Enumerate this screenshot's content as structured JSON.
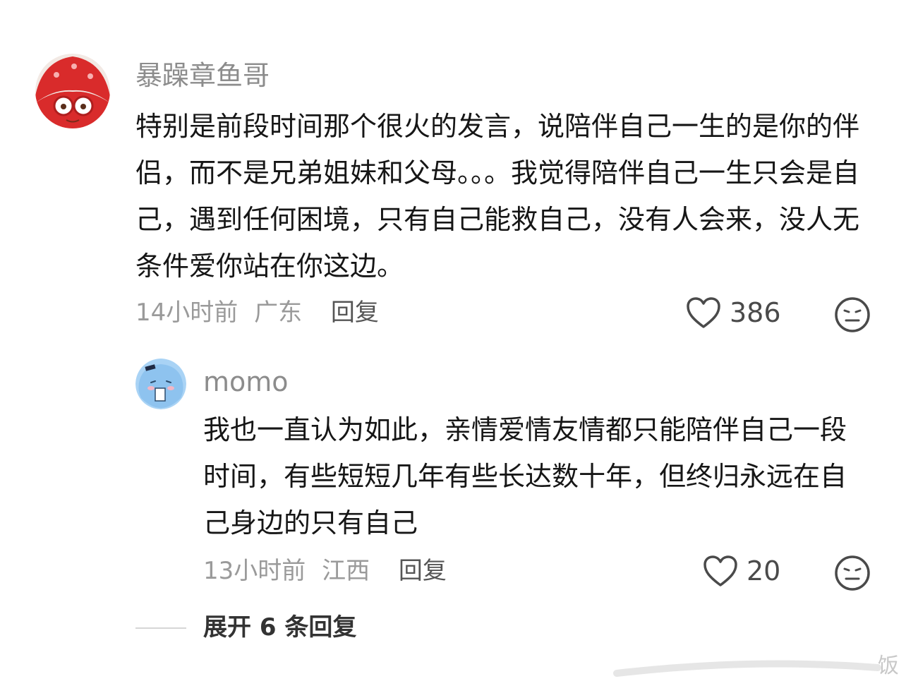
{
  "comment": {
    "username": "暴躁章鱼哥",
    "text": "特别是前段时间那个很火的发言，说陪伴自己一生的是你的伴侣，而不是兄弟姐妹和父母。。。我觉得陪伴自己一生只会是自己，遇到任何困境，只有自己能救自己，没有人会来，没人无条件爱你站在你这边。",
    "time": "14小时前",
    "location": "广东",
    "reply_label": "回复",
    "likes": "386"
  },
  "reply": {
    "username": "momo",
    "text": "我也一直认为如此，亲情爱情友情都只能陪伴自己一段时间，有些短短几年有些长达数十年，但终归永远在自己身边的只有自己",
    "time": "13小时前",
    "location": "江西",
    "reply_label": "回复",
    "likes": "20"
  },
  "expand": {
    "label": "展开 6 条回复"
  },
  "watermark": {
    "char": "饭"
  },
  "icons": {
    "like": "heart-outline-icon",
    "dislike": "neutral-face-icon"
  },
  "colors": {
    "username": "#8c8c8c",
    "meta": "#9a9a9a",
    "text": "#161616",
    "avatar_red": "#d92b2b",
    "avatar_blue": "#8ec3ef"
  }
}
